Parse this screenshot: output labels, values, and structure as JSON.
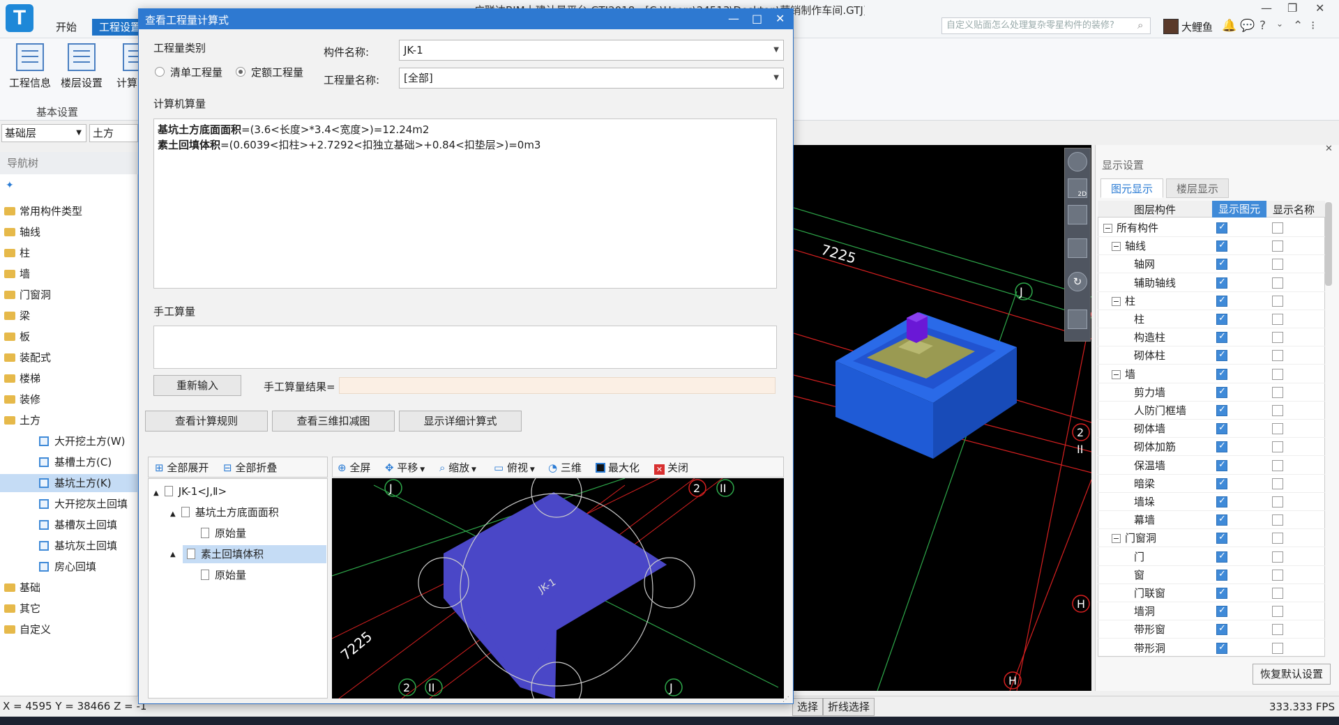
{
  "app": {
    "window_title": "广联达BIM土建计量平台 GTJ2018 - [C:\\Users\\24513\\Desktop\\营销制作车间.GTJ]",
    "menu_start": "开始",
    "menu_settings": "工程设置",
    "search_placeholder": "自定义贴面怎么处理复杂零星构件的装修?",
    "user_name": "大鲤鱼"
  },
  "ribbon": {
    "project_info": "工程信息",
    "floor_settings": "楼层设置",
    "calc": "计算",
    "group_label": "基本设置"
  },
  "left": {
    "floor_select": "基础层",
    "type_select": "土方",
    "nav_title": "导航树",
    "nav_items": [
      {
        "label": "常用构件类型"
      },
      {
        "label": "轴线"
      },
      {
        "label": "柱"
      },
      {
        "label": "墙"
      },
      {
        "label": "门窗洞"
      },
      {
        "label": "梁"
      },
      {
        "label": "板"
      },
      {
        "label": "装配式"
      },
      {
        "label": "楼梯"
      },
      {
        "label": "装修"
      },
      {
        "label": "土方"
      },
      {
        "label": "大开挖土方(W)"
      },
      {
        "label": "基槽土方(C)"
      },
      {
        "label": "基坑土方(K)"
      },
      {
        "label": "大开挖灰土回填"
      },
      {
        "label": "基槽灰土回填"
      },
      {
        "label": "基坑灰土回填"
      },
      {
        "label": "房心回填"
      },
      {
        "label": "基础"
      },
      {
        "label": "其它"
      },
      {
        "label": "自定义"
      }
    ]
  },
  "dialog": {
    "title": "查看工程量计算式",
    "qty_category": "工程量类别",
    "radio_list": "清单工程量",
    "radio_quota": "定额工程量",
    "component_name_label": "构件名称:",
    "component_name_value": "JK-1",
    "qty_name_label": "工程量名称:",
    "qty_name_value": "[全部]",
    "computer_calc": "计算机算量",
    "formula_1_name": "基坑土方底面面积",
    "formula_1_expr": "=(3.6<长度>*3.4<宽度>)=12.24m2",
    "formula_2_name": "素土回填体积",
    "formula_2_expr": "=(0.6039<扣柱>+2.7292<扣独立基础>+0.84<扣垫层>)=0m3",
    "manual_calc": "手工算量",
    "reinput": "重新输入",
    "manual_result_label": "手工算量结果=",
    "view_rules": "查看计算规则",
    "view_3d_deduct": "查看三维扣减图",
    "show_detail": "显示详细计算式",
    "expand_all": "全部展开",
    "collapse_all": "全部折叠",
    "plan_toolbar": {
      "fullscreen": "全屏",
      "pan": "平移",
      "zoom": "缩放",
      "top_view": "俯视",
      "three_d": "三维",
      "maximize": "最大化",
      "close": "关闭"
    },
    "tree": [
      {
        "label": "JK-1<J,Ⅱ>"
      },
      {
        "label": "基坑土方底面面积"
      },
      {
        "label": "原始量"
      },
      {
        "label": "素土回填体积"
      },
      {
        "label": "原始量"
      }
    ],
    "plan_view": {
      "component_label": "JK-1",
      "dim": "7225",
      "axis_j": "J",
      "axis_2": "2",
      "axis_ii": "II"
    }
  },
  "viewport3d": {
    "dim": "7225",
    "axis_j": "J",
    "axis_2": "2",
    "axis_ii": "II",
    "axis_h": "H",
    "view_badge": "2D"
  },
  "display_settings": {
    "title": "显示设置",
    "tab_elements": "图元显示",
    "tab_floors": "楼层显示",
    "col_component": "图层构件",
    "col_show_element": "显示图元",
    "col_show_name": "显示名称",
    "rows": [
      {
        "label": "所有构件",
        "toggle": "−"
      },
      {
        "label": "轴线",
        "toggle": "−"
      },
      {
        "label": "轴网",
        "toggle": ""
      },
      {
        "label": "辅助轴线",
        "toggle": ""
      },
      {
        "label": "柱",
        "toggle": "−"
      },
      {
        "label": "柱",
        "toggle": ""
      },
      {
        "label": "构造柱",
        "toggle": ""
      },
      {
        "label": "砌体柱",
        "toggle": ""
      },
      {
        "label": "墙",
        "toggle": "−"
      },
      {
        "label": "剪力墙",
        "toggle": ""
      },
      {
        "label": "人防门框墙",
        "toggle": ""
      },
      {
        "label": "砌体墙",
        "toggle": ""
      },
      {
        "label": "砌体加筋",
        "toggle": ""
      },
      {
        "label": "保温墙",
        "toggle": ""
      },
      {
        "label": "暗梁",
        "toggle": ""
      },
      {
        "label": "墙垛",
        "toggle": ""
      },
      {
        "label": "幕墙",
        "toggle": ""
      },
      {
        "label": "门窗洞",
        "toggle": "−"
      },
      {
        "label": "门",
        "toggle": ""
      },
      {
        "label": "窗",
        "toggle": ""
      },
      {
        "label": "门联窗",
        "toggle": ""
      },
      {
        "label": "墙洞",
        "toggle": ""
      },
      {
        "label": "带形窗",
        "toggle": ""
      },
      {
        "label": "带形洞",
        "toggle": ""
      }
    ],
    "restore": "恢复默认设置"
  },
  "status": {
    "coords": "X = 4595 Y = 38466 Z = -1",
    "btn_select": "选择",
    "btn_polyline": "折线选择",
    "fps": "333.333 FPS"
  },
  "colors": {
    "dialog_title": "#2e79d1",
    "pit_blue": "#1f5bd6",
    "plan_fill": "#4a47c7",
    "column_purple": "#6a18d6",
    "footing_olive": "#9a9a52"
  }
}
